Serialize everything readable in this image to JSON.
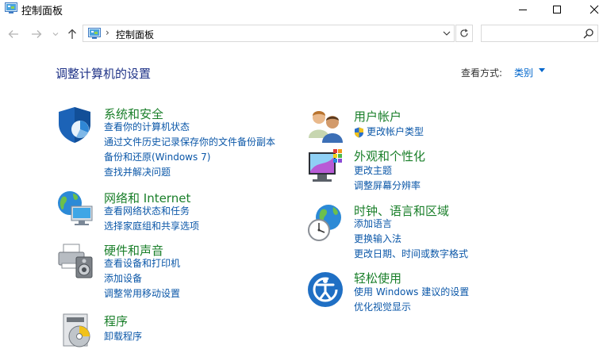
{
  "window": {
    "title": "控制面板"
  },
  "address": {
    "path": "控制面板",
    "search_placeholder": ""
  },
  "heading": {
    "title": "调整计算机的设置",
    "view_label": "查看方式:",
    "view_value": "类别"
  },
  "categories": {
    "system_security": {
      "title": "系统和安全",
      "links": [
        "查看你的计算机状态",
        "通过文件历史记录保存你的文件备份副本",
        "备份和还原(Windows 7)",
        "查找并解决问题"
      ]
    },
    "network": {
      "title": "网络和 Internet",
      "links": [
        "查看网络状态和任务",
        "选择家庭组和共享选项"
      ]
    },
    "hardware": {
      "title": "硬件和声音",
      "links": [
        "查看设备和打印机",
        "添加设备",
        "调整常用移动设置"
      ]
    },
    "programs": {
      "title": "程序",
      "links": [
        "卸载程序"
      ]
    },
    "user_accounts": {
      "title": "用户帐户",
      "links": [
        "更改帐户类型"
      ]
    },
    "appearance": {
      "title": "外观和个性化",
      "links": [
        "更改主题",
        "调整屏幕分辨率"
      ]
    },
    "clock_region": {
      "title": "时钟、语言和区域",
      "links": [
        "添加语言",
        "更换输入法",
        "更改日期、时间或数字格式"
      ]
    },
    "ease_access": {
      "title": "轻松使用",
      "links": [
        "使用 Windows 建议的设置",
        "优化视觉显示"
      ]
    }
  },
  "icons": {
    "app": "control-panel-icon",
    "back": "arrow-left-icon",
    "forward": "arrow-right-icon",
    "up": "arrow-up-icon",
    "refresh": "refresh-icon",
    "search": "search-icon",
    "minimize": "minimize-icon",
    "maximize": "maximize-icon",
    "close": "close-icon"
  },
  "colors": {
    "category_title": "#1a7f2a",
    "link": "#0b57a8",
    "heading": "#1e3287",
    "view_value": "#0066cc"
  }
}
